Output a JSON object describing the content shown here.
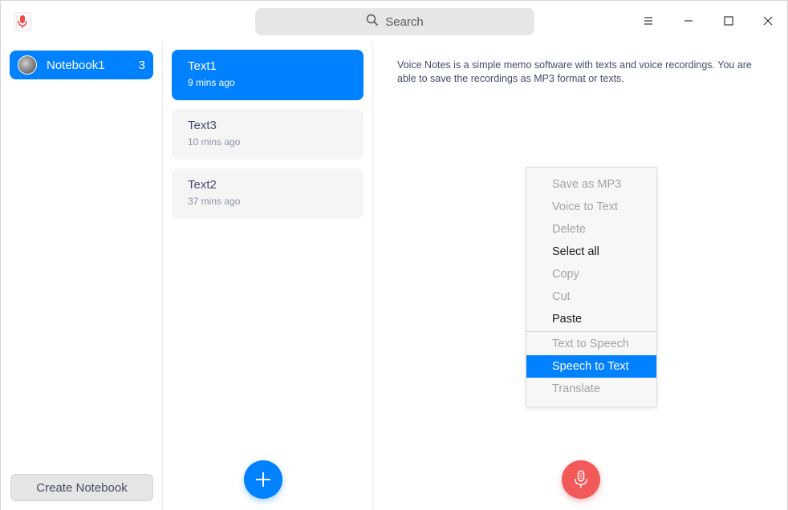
{
  "titlebar": {
    "search_placeholder": "Search",
    "app_icon": "microphone-app-icon",
    "menu_icon": "hamburger-menu-icon",
    "minimize_icon": "minimize-icon",
    "maximize_icon": "maximize-icon",
    "close_icon": "close-icon"
  },
  "sidebar": {
    "notebooks": [
      {
        "name": "Notebook1",
        "count": "3",
        "selected": true
      }
    ],
    "create_label": "Create Notebook"
  },
  "notes": [
    {
      "title": "Text1",
      "time": "9 mins ago",
      "selected": true
    },
    {
      "title": "Text3",
      "time": "10 mins ago",
      "selected": false
    },
    {
      "title": "Text2",
      "time": "37 mins ago",
      "selected": false
    }
  ],
  "editor": {
    "content": "Voice Notes is a simple memo software with texts and voice recordings. You are able to save the recordings as MP3 format or texts."
  },
  "context_menu": {
    "items": [
      {
        "label": "Save as MP3",
        "enabled": false
      },
      {
        "label": "Voice to Text",
        "enabled": false
      },
      {
        "label": "Delete",
        "enabled": false
      },
      {
        "label": "Select all",
        "enabled": true
      },
      {
        "label": "Copy",
        "enabled": false
      },
      {
        "label": "Cut",
        "enabled": false
      },
      {
        "label": "Paste",
        "enabled": true
      },
      {
        "label": "Text to Speech",
        "enabled": false
      },
      {
        "label": "Speech to Text",
        "enabled": true,
        "selected": true
      },
      {
        "label": "Translate",
        "enabled": false
      }
    ]
  },
  "colors": {
    "accent": "#0081ff",
    "record": "#f25a5a"
  }
}
